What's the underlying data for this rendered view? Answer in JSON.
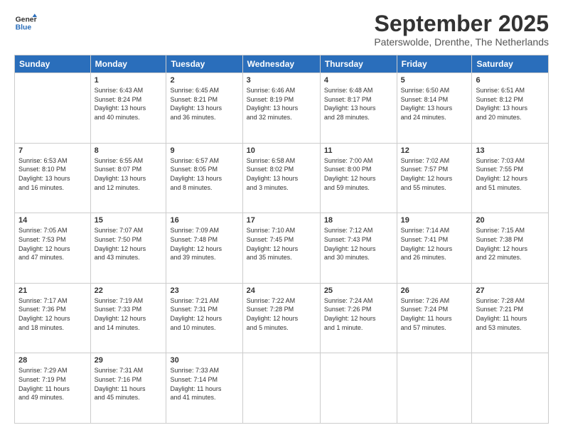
{
  "header": {
    "logo_line1": "General",
    "logo_line2": "Blue",
    "month": "September 2025",
    "location": "Paterswolde, Drenthe, The Netherlands"
  },
  "weekdays": [
    "Sunday",
    "Monday",
    "Tuesday",
    "Wednesday",
    "Thursday",
    "Friday",
    "Saturday"
  ],
  "weeks": [
    [
      {
        "day": "",
        "info": ""
      },
      {
        "day": "1",
        "info": "Sunrise: 6:43 AM\nSunset: 8:24 PM\nDaylight: 13 hours\nand 40 minutes."
      },
      {
        "day": "2",
        "info": "Sunrise: 6:45 AM\nSunset: 8:21 PM\nDaylight: 13 hours\nand 36 minutes."
      },
      {
        "day": "3",
        "info": "Sunrise: 6:46 AM\nSunset: 8:19 PM\nDaylight: 13 hours\nand 32 minutes."
      },
      {
        "day": "4",
        "info": "Sunrise: 6:48 AM\nSunset: 8:17 PM\nDaylight: 13 hours\nand 28 minutes."
      },
      {
        "day": "5",
        "info": "Sunrise: 6:50 AM\nSunset: 8:14 PM\nDaylight: 13 hours\nand 24 minutes."
      },
      {
        "day": "6",
        "info": "Sunrise: 6:51 AM\nSunset: 8:12 PM\nDaylight: 13 hours\nand 20 minutes."
      }
    ],
    [
      {
        "day": "7",
        "info": "Sunrise: 6:53 AM\nSunset: 8:10 PM\nDaylight: 13 hours\nand 16 minutes."
      },
      {
        "day": "8",
        "info": "Sunrise: 6:55 AM\nSunset: 8:07 PM\nDaylight: 13 hours\nand 12 minutes."
      },
      {
        "day": "9",
        "info": "Sunrise: 6:57 AM\nSunset: 8:05 PM\nDaylight: 13 hours\nand 8 minutes."
      },
      {
        "day": "10",
        "info": "Sunrise: 6:58 AM\nSunset: 8:02 PM\nDaylight: 13 hours\nand 3 minutes."
      },
      {
        "day": "11",
        "info": "Sunrise: 7:00 AM\nSunset: 8:00 PM\nDaylight: 12 hours\nand 59 minutes."
      },
      {
        "day": "12",
        "info": "Sunrise: 7:02 AM\nSunset: 7:57 PM\nDaylight: 12 hours\nand 55 minutes."
      },
      {
        "day": "13",
        "info": "Sunrise: 7:03 AM\nSunset: 7:55 PM\nDaylight: 12 hours\nand 51 minutes."
      }
    ],
    [
      {
        "day": "14",
        "info": "Sunrise: 7:05 AM\nSunset: 7:53 PM\nDaylight: 12 hours\nand 47 minutes."
      },
      {
        "day": "15",
        "info": "Sunrise: 7:07 AM\nSunset: 7:50 PM\nDaylight: 12 hours\nand 43 minutes."
      },
      {
        "day": "16",
        "info": "Sunrise: 7:09 AM\nSunset: 7:48 PM\nDaylight: 12 hours\nand 39 minutes."
      },
      {
        "day": "17",
        "info": "Sunrise: 7:10 AM\nSunset: 7:45 PM\nDaylight: 12 hours\nand 35 minutes."
      },
      {
        "day": "18",
        "info": "Sunrise: 7:12 AM\nSunset: 7:43 PM\nDaylight: 12 hours\nand 30 minutes."
      },
      {
        "day": "19",
        "info": "Sunrise: 7:14 AM\nSunset: 7:41 PM\nDaylight: 12 hours\nand 26 minutes."
      },
      {
        "day": "20",
        "info": "Sunrise: 7:15 AM\nSunset: 7:38 PM\nDaylight: 12 hours\nand 22 minutes."
      }
    ],
    [
      {
        "day": "21",
        "info": "Sunrise: 7:17 AM\nSunset: 7:36 PM\nDaylight: 12 hours\nand 18 minutes."
      },
      {
        "day": "22",
        "info": "Sunrise: 7:19 AM\nSunset: 7:33 PM\nDaylight: 12 hours\nand 14 minutes."
      },
      {
        "day": "23",
        "info": "Sunrise: 7:21 AM\nSunset: 7:31 PM\nDaylight: 12 hours\nand 10 minutes."
      },
      {
        "day": "24",
        "info": "Sunrise: 7:22 AM\nSunset: 7:28 PM\nDaylight: 12 hours\nand 5 minutes."
      },
      {
        "day": "25",
        "info": "Sunrise: 7:24 AM\nSunset: 7:26 PM\nDaylight: 12 hours\nand 1 minute."
      },
      {
        "day": "26",
        "info": "Sunrise: 7:26 AM\nSunset: 7:24 PM\nDaylight: 11 hours\nand 57 minutes."
      },
      {
        "day": "27",
        "info": "Sunrise: 7:28 AM\nSunset: 7:21 PM\nDaylight: 11 hours\nand 53 minutes."
      }
    ],
    [
      {
        "day": "28",
        "info": "Sunrise: 7:29 AM\nSunset: 7:19 PM\nDaylight: 11 hours\nand 49 minutes."
      },
      {
        "day": "29",
        "info": "Sunrise: 7:31 AM\nSunset: 7:16 PM\nDaylight: 11 hours\nand 45 minutes."
      },
      {
        "day": "30",
        "info": "Sunrise: 7:33 AM\nSunset: 7:14 PM\nDaylight: 11 hours\nand 41 minutes."
      },
      {
        "day": "",
        "info": ""
      },
      {
        "day": "",
        "info": ""
      },
      {
        "day": "",
        "info": ""
      },
      {
        "day": "",
        "info": ""
      }
    ]
  ]
}
